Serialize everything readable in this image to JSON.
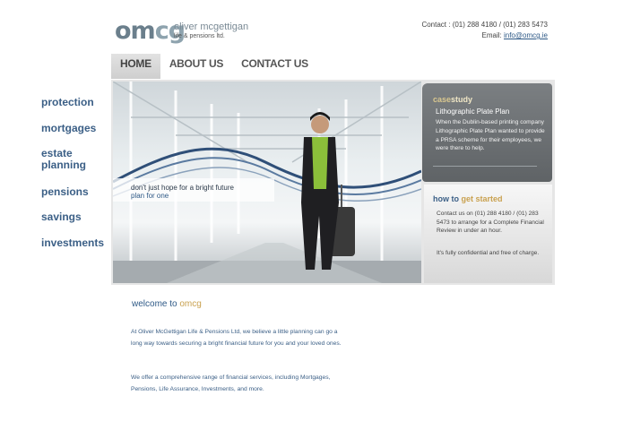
{
  "brand": {
    "mark_part1": "om",
    "mark_part2": "cg",
    "name": "oliver mcgettigan",
    "subtitle": "life & pensions ltd.",
    "accent": "#2f5a87",
    "gold": "#c9a14f"
  },
  "contact": {
    "phone": "Contact : (01) 288 4180 / (01) 283 5473",
    "email_label": "Email: ",
    "email": "info@omcg.ie"
  },
  "nav": {
    "tabs": [
      {
        "label": "HOME",
        "active": true
      },
      {
        "label": "ABOUT US",
        "active": false
      },
      {
        "label": "CONTACT US",
        "active": false
      }
    ]
  },
  "sidebar": {
    "items": [
      {
        "label": "protection"
      },
      {
        "label": "mortgages"
      },
      {
        "label": "estate planning"
      },
      {
        "label": "pensions"
      },
      {
        "label": "savings"
      },
      {
        "label": "investments"
      }
    ]
  },
  "hero": {
    "tagline": "don't just hope for a bright future",
    "tagline_sub": "plan for one"
  },
  "case_study": {
    "title_a": "case",
    "title_b": "study",
    "subtitle": "Lithographic Plate Plan",
    "body": "When the Dublin-based printing company Lithographic Plate Plan wanted to provide a PRSA scheme for their employees, we were there to help."
  },
  "get_started": {
    "title_a": "how to ",
    "title_b": "get started",
    "body": "Contact us on (01) 288 4180 / (01) 283 5473 to arrange for a Complete Financial Review in under an hour.",
    "note": "It's fully confidential and free of charge."
  },
  "welcome": {
    "title_a": "welcome to ",
    "title_b": "omcg",
    "p1": "At Oliver McGettigan Life & Pensions Ltd, we believe a little planning can go a long way towards securing a bright financial future for you and your loved ones.",
    "p2": "We offer a comprehensive range of financial services, including Mortgages, Pensions, Life Assurance, Investments, and more."
  }
}
